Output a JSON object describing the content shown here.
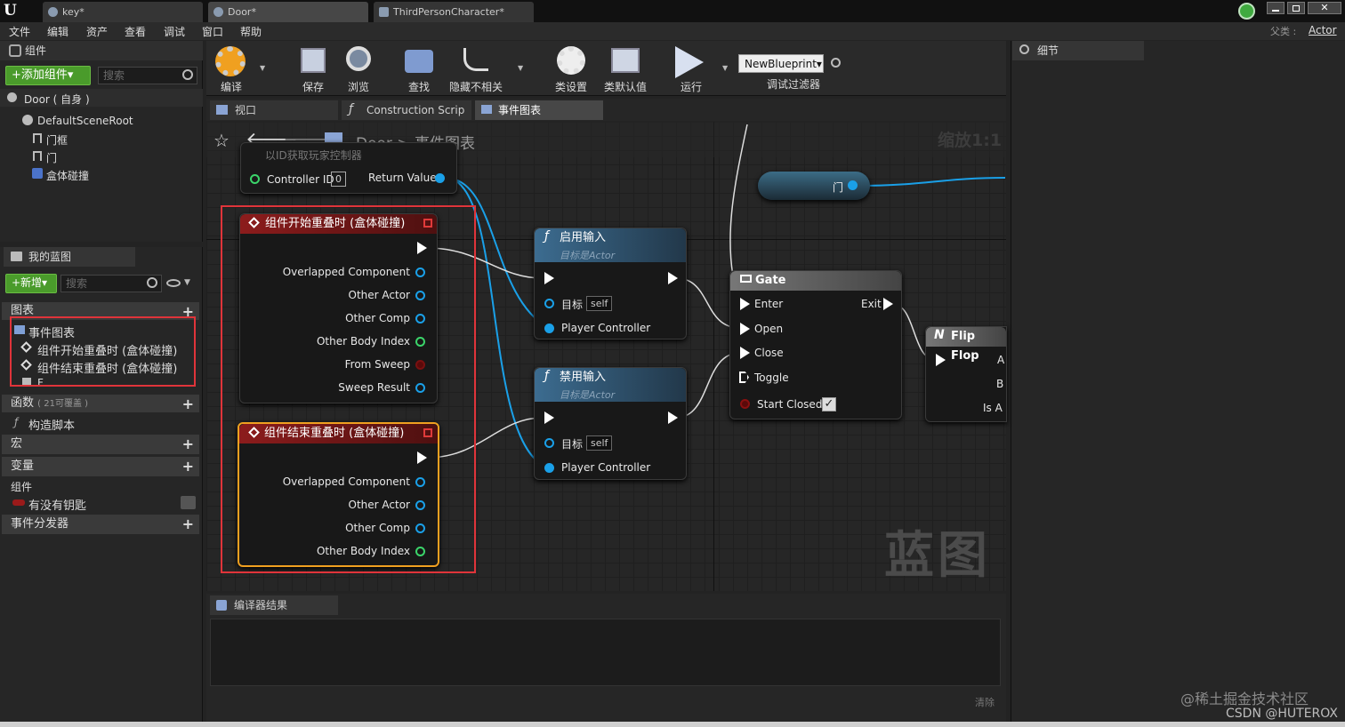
{
  "tabs": [
    {
      "label": "key*"
    },
    {
      "label": "Door*"
    },
    {
      "label": "ThirdPersonCharacter*"
    }
  ],
  "menu": [
    "文件",
    "编辑",
    "资产",
    "查看",
    "调试",
    "窗口",
    "帮助"
  ],
  "parent_class": {
    "label": "父类 :",
    "value": "Actor"
  },
  "components_panel": {
    "title": "组件",
    "add_button": "+添加组件▾",
    "search_placeholder": "搜索",
    "self_item": "Door ( 自身 )",
    "tree": [
      "DefaultSceneRoot",
      "门框",
      "门",
      "盒体碰撞"
    ]
  },
  "my_blueprint": {
    "title": "我的蓝图",
    "add_button": "+新增▾",
    "search_placeholder": "搜索",
    "graphs_label": "图表",
    "event_graph": "事件图表",
    "events": [
      "组件开始重叠时 (盒体碰撞)",
      "组件结束重叠时 (盒体碰撞)"
    ],
    "extra_item": "F",
    "functions_label": "函数",
    "functions_count": "( 21可覆盖 )",
    "construct": "构造脚本",
    "macros": "宏",
    "variables": "变量",
    "components_cat": "组件",
    "var_key": "有没有钥匙",
    "dispatchers": "事件分发器"
  },
  "toolbar": [
    {
      "label": "编译",
      "icon": "compile-icon"
    },
    {
      "label": "保存",
      "icon": "save-icon"
    },
    {
      "label": "浏览",
      "icon": "browse-icon"
    },
    {
      "label": "查找",
      "icon": "find-icon"
    },
    {
      "label": "隐藏不相关",
      "icon": "hide-unrelated-icon"
    },
    {
      "label": "类设置",
      "icon": "class-settings-icon"
    },
    {
      "label": "类默认值",
      "icon": "class-defaults-icon"
    },
    {
      "label": "运行",
      "icon": "play-icon"
    }
  ],
  "debug_filter": {
    "value": "NewBlueprint▾",
    "label": "调试过滤器"
  },
  "details_title": "细节",
  "graph_tabs": [
    "视口",
    "Construction Scrip",
    "事件图表"
  ],
  "breadcrumb": {
    "root": "Door",
    "sep": ">",
    "current": "事件图表"
  },
  "zoom": "缩放1:1",
  "watermark": "蓝图",
  "nodes": {
    "controller": {
      "title": "以ID获取玩家控制器",
      "controller_id": "Controller ID",
      "id_value": "0",
      "return": "Return Value"
    },
    "begin_overlap": {
      "title": "组件开始重叠时 (盒体碰撞)",
      "pins": [
        "Overlapped Component",
        "Other Actor",
        "Other Comp",
        "Other Body Index",
        "From Sweep",
        "Sweep Result"
      ]
    },
    "end_overlap": {
      "title": "组件结束重叠时 (盒体碰撞)",
      "pins": [
        "Overlapped Component",
        "Other Actor",
        "Other Comp",
        "Other Body Index"
      ]
    },
    "enable_input": {
      "title": "启用输入",
      "subtitle": "目标是Actor",
      "target": "目标",
      "self": "self",
      "pc": "Player Controller"
    },
    "disable_input": {
      "title": "禁用输入",
      "subtitle": "目标是Actor",
      "target": "目标",
      "self": "self",
      "pc": "Player Controller"
    },
    "gate": {
      "title": "Gate",
      "pins": [
        "Enter",
        "Open",
        "Close",
        "Toggle",
        "Start Closed"
      ],
      "exit": "Exit"
    },
    "flipflop": {
      "title": "Flip Flop",
      "pins": [
        "A",
        "B",
        "Is A"
      ]
    },
    "door_var": {
      "label": "门"
    }
  },
  "compiler": {
    "title": "编译器结果",
    "clear": "清除"
  },
  "footer": {
    "wm1": "@稀土掘金技术社区",
    "wm2": "CSDN @HUTEROX"
  }
}
